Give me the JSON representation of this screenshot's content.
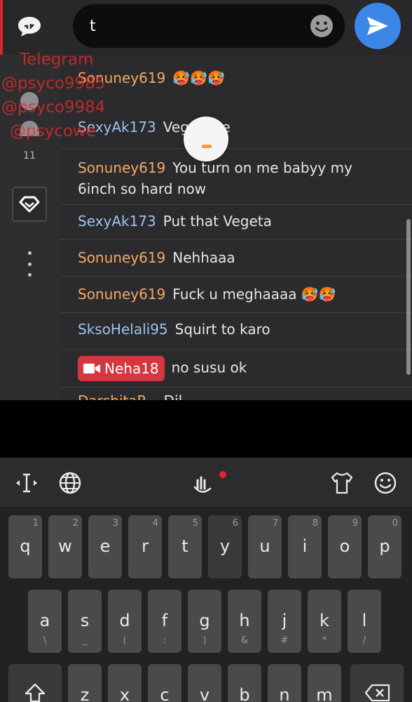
{
  "composer": {
    "input_value": "t",
    "input_placeholder": ""
  },
  "sidebar": {
    "viewer_count": "11"
  },
  "watermark": {
    "line1": "Telegram",
    "line2": "@psyco9985",
    "line3": "@psyco9984",
    "line4": "@psycowe"
  },
  "messages": [
    {
      "user": "Sonuney619",
      "text": "🥵🥵🥵",
      "user_color": "#f5a865"
    },
    {
      "user": "SexyAk173",
      "text": "Vegeta re",
      "user_color": "#9ec0ee"
    },
    {
      "user": "Sonuney619",
      "text": "You turn on me babyy my 6inch so hard now",
      "user_color": "#f5a865"
    },
    {
      "user": "SexyAk173",
      "text": "Put that Vegeta",
      "user_color": "#9ec0ee"
    },
    {
      "user": "Sonuney619",
      "text": "Nehhaaa",
      "user_color": "#f5a865"
    },
    {
      "user": "Sonuney619",
      "text": "Fuck u meghaaaa 🥵🥵",
      "user_color": "#f5a865"
    },
    {
      "user": "SksoHelali95",
      "text": "Squirt to karo",
      "user_color": "#9ec0ee"
    },
    {
      "user": "Neha18",
      "text": "no susu ok",
      "user_color": "#ffffff",
      "badge": "video-camera-icon"
    },
    {
      "user": "DarshitaP...",
      "text": "Dil...",
      "user_color": "#f5a865"
    }
  ],
  "keyboard": {
    "row1": [
      {
        "k": "q",
        "s": "1"
      },
      {
        "k": "w",
        "s": "2"
      },
      {
        "k": "e",
        "s": "3"
      },
      {
        "k": "r",
        "s": "4"
      },
      {
        "k": "t",
        "s": "5"
      },
      {
        "k": "y",
        "s": "6"
      },
      {
        "k": "u",
        "s": "7"
      },
      {
        "k": "i",
        "s": "8"
      },
      {
        "k": "o",
        "s": "9"
      },
      {
        "k": "p",
        "s": "0"
      }
    ],
    "row2": [
      {
        "k": "a",
        "s": "\\"
      },
      {
        "k": "s",
        "s": "_"
      },
      {
        "k": "d",
        "s": "("
      },
      {
        "k": "f",
        "s": ":"
      },
      {
        "k": "g",
        "s": ")"
      },
      {
        "k": "h",
        "s": "&"
      },
      {
        "k": "j",
        "s": "#"
      },
      {
        "k": "k",
        "s": "*"
      },
      {
        "k": "l",
        "s": "/"
      }
    ],
    "row3": [
      {
        "k": "z"
      },
      {
        "k": "x"
      },
      {
        "k": "c"
      },
      {
        "k": "v"
      },
      {
        "k": "b"
      },
      {
        "k": "n"
      },
      {
        "k": "m"
      }
    ],
    "accent_color": "#3b86e6",
    "record_dot_color": "#e5252f"
  },
  "colors": {
    "brand_red": "#d6363f",
    "username_orange": "#f5a865",
    "username_blue": "#9ec0ee"
  }
}
